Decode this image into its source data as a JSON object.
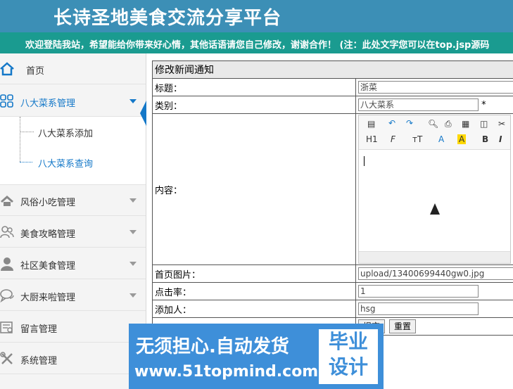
{
  "header": {
    "title": "长诗圣地美食交流分享平台",
    "notice": "欢迎登陆我站，希望能给你带来好心情，其他话语请您自己修改，谢谢合作！ (注：此处文字您可以在top.jsp源码"
  },
  "sidebar": {
    "items": [
      {
        "label": "首页",
        "icon": "home-icon"
      },
      {
        "label": "八大菜系管理",
        "icon": "grid-icon"
      },
      {
        "label": "风俗小吃管理",
        "icon": "house-icon"
      },
      {
        "label": "美食攻略管理",
        "icon": "users-icon"
      },
      {
        "label": "社区美食管理",
        "icon": "user-icon"
      },
      {
        "label": "大厨来啦管理",
        "icon": "chat-icon"
      },
      {
        "label": "留言管理",
        "icon": "form-icon"
      },
      {
        "label": "系统管理",
        "icon": "tools-icon"
      }
    ],
    "submenu": [
      {
        "label": "八大菜系添加"
      },
      {
        "label": "八大菜系查询"
      }
    ]
  },
  "form": {
    "heading": "修改新闻通知",
    "title_label": "标题：",
    "title_value": "浙菜",
    "category_label": "类别：",
    "category_value": "八大菜系",
    "required_mark": "*",
    "content_label": "内容：",
    "image_label": "首页图片：",
    "image_value": "upload/13400699440gw0.jpg",
    "clicks_label": "点击率：",
    "clicks_value": "1",
    "author_label": "添加人：",
    "author_value": "hsg",
    "submit_label": "提交",
    "reset_label": "重置"
  },
  "editor": {
    "toolbar_row2": [
      "H1",
      "F",
      "тT",
      "A",
      "A",
      "B",
      "I"
    ]
  },
  "watermark": {
    "line1": "无须担心.自动发货",
    "line2": "www.51topmind.com",
    "box_line1": "毕业",
    "box_line2": "设计"
  },
  "colors": {
    "header": "#3c8fb6",
    "notice": "#1a9b90",
    "accent": "#1478c8",
    "watermark": "#3e8fd9"
  }
}
